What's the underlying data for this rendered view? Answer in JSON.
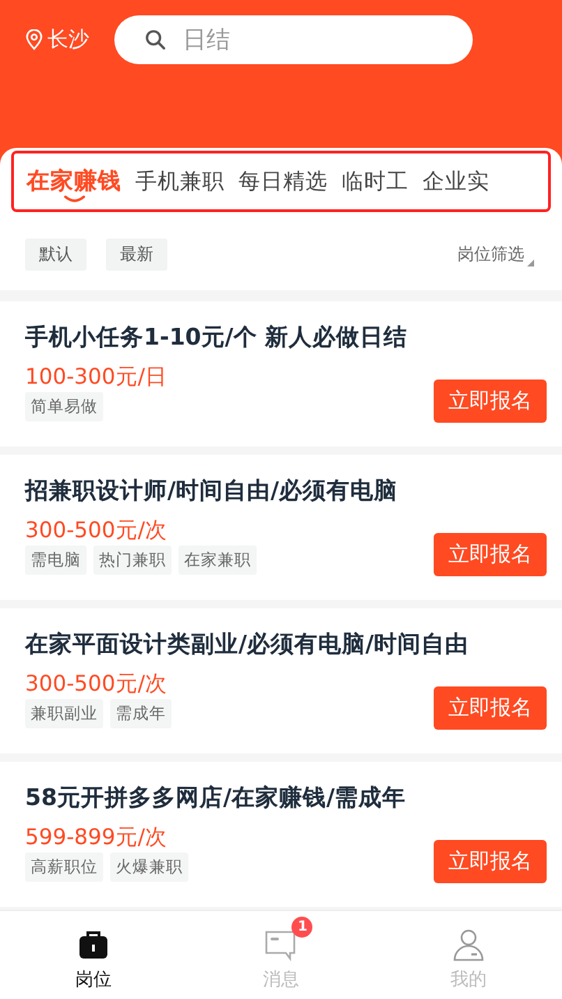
{
  "header": {
    "location": "长沙",
    "search": {
      "placeholder": "日结"
    }
  },
  "tabs": [
    {
      "label": "在家赚钱",
      "selected": true
    },
    {
      "label": "手机兼职",
      "selected": false
    },
    {
      "label": "每日精选",
      "selected": false
    },
    {
      "label": "临时工",
      "selected": false
    },
    {
      "label": "企业实",
      "selected": false
    }
  ],
  "sort_options": [
    "默认",
    "最新"
  ],
  "filter": "岗位筛选",
  "jobs": [
    {
      "title": "手机小任务1-10元/个 新人必做日结",
      "pay": "100-300元/日",
      "tags": [
        "简单易做"
      ],
      "button": "立即报名"
    },
    {
      "title": "招兼职设计师/时间自由/必须有电脑",
      "pay": "300-500元/次",
      "tags": [
        "需电脑",
        "热门兼职",
        "在家兼职"
      ],
      "button": "立即报名"
    },
    {
      "title": "在家平面设计类副业/必须有电脑/时间自由",
      "pay": "300-500元/次",
      "tags": [
        "兼职副业",
        "需成年"
      ],
      "button": "立即报名"
    },
    {
      "title": "58元开拼多多网店/在家赚钱/需成年",
      "pay": "599-899元/次",
      "tags": [
        "高薪职位",
        "火爆兼职"
      ],
      "button": "立即报名"
    }
  ],
  "nav": [
    {
      "kind": "briefcase",
      "label": "岗位",
      "selected": true
    },
    {
      "kind": "message",
      "label": "消息",
      "selected": false,
      "badge": "1"
    },
    {
      "kind": "person",
      "label": "我的",
      "selected": false
    }
  ]
}
